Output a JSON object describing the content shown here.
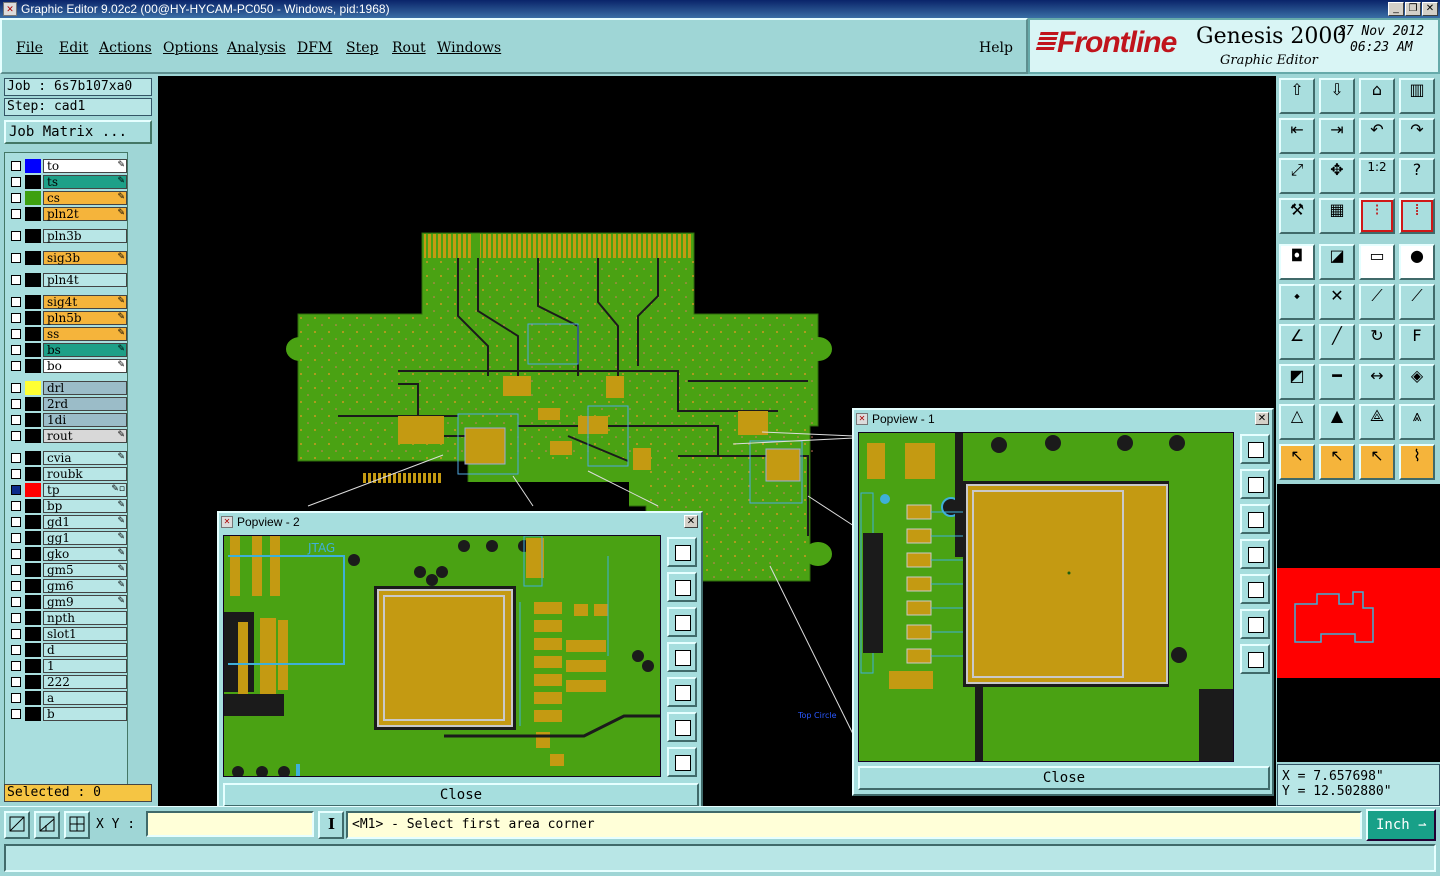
{
  "window": {
    "title": "Graphic Editor 9.02c2 (00@HY-HYCAM-PC050 - Windows, pid:1968)",
    "controls": [
      "_",
      "❐",
      "✕"
    ]
  },
  "menu": [
    "File",
    "Edit",
    "Actions",
    "Options",
    "Analysis",
    "DFM",
    "Step",
    "Rout",
    "Windows"
  ],
  "help_label": "Help",
  "branding": {
    "logo": "Frontline",
    "product": "Genesis 2000",
    "subtitle": "Graphic Editor",
    "date": "27 Nov 2012",
    "time": "06:23 AM"
  },
  "job": {
    "job_text": "Job : 6s7b107xa0",
    "step_text": "Step: cad1",
    "matrix_label": "Job Matrix ..."
  },
  "layers": [
    {
      "name": "to",
      "swatch": "#0000ff",
      "bg": "#ffffff",
      "pen": "✎",
      "group": 0,
      "active": false
    },
    {
      "name": "ts",
      "swatch": "#000000",
      "bg": "#1ea088",
      "pen": "✎",
      "group": 0,
      "active": false
    },
    {
      "name": "cs",
      "swatch": "#3ea010",
      "bg": "#f5b43b",
      "pen": "✎",
      "group": 0,
      "active": false
    },
    {
      "name": "pln2t",
      "swatch": "#000000",
      "bg": "#f5b43b",
      "pen": "✎",
      "group": 0,
      "active": false
    },
    {
      "name": "pln3b",
      "swatch": "#000000",
      "bg": "#b8e6e6",
      "pen": "",
      "group": 1,
      "active": false
    },
    {
      "name": "sig3b",
      "swatch": "#000000",
      "bg": "#f5b43b",
      "pen": "✎",
      "group": 2,
      "active": false
    },
    {
      "name": "pln4t",
      "swatch": "#000000",
      "bg": "#b8e6e6",
      "pen": "",
      "group": 3,
      "active": false
    },
    {
      "name": "sig4t",
      "swatch": "#000000",
      "bg": "#f5b43b",
      "pen": "✎",
      "group": 4,
      "active": false
    },
    {
      "name": "pln5b",
      "swatch": "#000000",
      "bg": "#f5b43b",
      "pen": "✎",
      "group": 4,
      "active": false
    },
    {
      "name": "ss",
      "swatch": "#000000",
      "bg": "#f5b43b",
      "pen": "✎",
      "group": 4,
      "active": false
    },
    {
      "name": "bs",
      "swatch": "#000000",
      "bg": "#1ea088",
      "pen": "✎",
      "group": 4,
      "active": false
    },
    {
      "name": "bo",
      "swatch": "#000000",
      "bg": "#ffffff",
      "pen": "✎",
      "group": 4,
      "active": false
    },
    {
      "name": "drl",
      "swatch": "#ffff33",
      "bg": "#9bbcc8",
      "pen": "",
      "group": 5,
      "active": false
    },
    {
      "name": "2rd",
      "swatch": "#000000",
      "bg": "#9bbcc8",
      "pen": "",
      "group": 5,
      "active": false
    },
    {
      "name": "1di",
      "swatch": "#000000",
      "bg": "#9bbcc8",
      "pen": "",
      "group": 5,
      "active": false
    },
    {
      "name": "rout",
      "swatch": "#000000",
      "bg": "#d8d8d8",
      "pen": "✎",
      "group": 5,
      "active": false
    },
    {
      "name": "cvia",
      "swatch": "#000000",
      "bg": "#b8e6e6",
      "pen": "✎",
      "group": 6,
      "active": false
    },
    {
      "name": "roubk",
      "swatch": "#000000",
      "bg": "#b8e6e6",
      "pen": "",
      "group": 6,
      "active": false
    },
    {
      "name": "tp",
      "swatch": "#ff0000",
      "bg": "#b8e6e6",
      "pen": "✎▫",
      "group": 6,
      "active": true
    },
    {
      "name": "bp",
      "swatch": "#000000",
      "bg": "#b8e6e6",
      "pen": "✎",
      "group": 6,
      "active": false
    },
    {
      "name": "gd1",
      "swatch": "#000000",
      "bg": "#b8e6e6",
      "pen": "✎",
      "group": 6,
      "active": false
    },
    {
      "name": "gg1",
      "swatch": "#000000",
      "bg": "#b8e6e6",
      "pen": "✎",
      "group": 6,
      "active": false
    },
    {
      "name": "gko",
      "swatch": "#000000",
      "bg": "#b8e6e6",
      "pen": "✎",
      "group": 6,
      "active": false
    },
    {
      "name": "gm5",
      "swatch": "#000000",
      "bg": "#b8e6e6",
      "pen": "✎",
      "group": 6,
      "active": false
    },
    {
      "name": "gm6",
      "swatch": "#000000",
      "bg": "#b8e6e6",
      "pen": "✎",
      "group": 6,
      "active": false
    },
    {
      "name": "gm9",
      "swatch": "#000000",
      "bg": "#b8e6e6",
      "pen": "✎",
      "group": 6,
      "active": false
    },
    {
      "name": "npth",
      "swatch": "#000000",
      "bg": "#b8e6e6",
      "pen": "",
      "group": 6,
      "active": false
    },
    {
      "name": "slot1",
      "swatch": "#000000",
      "bg": "#b8e6e6",
      "pen": "",
      "group": 6,
      "active": false
    },
    {
      "name": "d",
      "swatch": "#000000",
      "bg": "#b8e6e6",
      "pen": "",
      "group": 6,
      "active": false
    },
    {
      "name": "1",
      "swatch": "#000000",
      "bg": "#b8e6e6",
      "pen": "",
      "group": 6,
      "active": false
    },
    {
      "name": "222",
      "swatch": "#000000",
      "bg": "#b8e6e6",
      "pen": "",
      "group": 6,
      "active": false
    },
    {
      "name": "a",
      "swatch": "#000000",
      "bg": "#b8e6e6",
      "pen": "",
      "group": 6,
      "active": false
    },
    {
      "name": "b",
      "swatch": "#000000",
      "bg": "#b8e6e6",
      "pen": "",
      "group": 6,
      "active": false
    }
  ],
  "selected_text": "Selected : 0",
  "popview1": {
    "title": "Popview - 1",
    "close_label": "Close"
  },
  "popview2": {
    "title": "Popview - 2",
    "close_label": "Close",
    "silk_text": "JTAG"
  },
  "canvas_annotation": "Top Circle",
  "toolbar_icons": [
    {
      "name": "load-icon",
      "glyph": "⇧",
      "style": "plain"
    },
    {
      "name": "save-icon",
      "glyph": "⇩",
      "style": "plain"
    },
    {
      "name": "home-icon",
      "glyph": "⌂",
      "style": "plain"
    },
    {
      "name": "window-split-icon",
      "glyph": "▥",
      "style": "plain"
    },
    {
      "name": "pan-left-icon",
      "glyph": "⇤",
      "style": "plain"
    },
    {
      "name": "pan-right-icon",
      "glyph": "⇥",
      "style": "plain"
    },
    {
      "name": "undo-icon",
      "glyph": "↶",
      "style": "plain"
    },
    {
      "name": "redo-icon",
      "glyph": "↷",
      "style": "plain"
    },
    {
      "name": "fit-vertical-icon",
      "glyph": "⤢",
      "style": "plain"
    },
    {
      "name": "zoom-center-icon",
      "glyph": "✥",
      "style": "plain"
    },
    {
      "name": "scale-1-2-icon",
      "glyph": "1:2",
      "style": "plain"
    },
    {
      "name": "help-icon",
      "glyph": "?",
      "style": "plain"
    },
    {
      "name": "tools-icon",
      "glyph": "⚒",
      "style": "plain"
    },
    {
      "name": "grid-icon",
      "glyph": "▦",
      "style": "plain"
    },
    {
      "name": "net-red-icon",
      "glyph": "⁝",
      "style": "red"
    },
    {
      "name": "net-red-2-icon",
      "glyph": "⁞",
      "style": "red"
    },
    {
      "name": "cursor-pad-icon",
      "glyph": "◘",
      "style": "white"
    },
    {
      "name": "measure-angle-icon",
      "glyph": "◪",
      "style": "plain"
    },
    {
      "name": "ruler-icon",
      "glyph": "▭",
      "style": "white"
    },
    {
      "name": "dot-select-icon",
      "glyph": "●",
      "style": "white"
    },
    {
      "name": "connect-pads-icon",
      "glyph": "⬩",
      "style": "plain"
    },
    {
      "name": "cross-icon",
      "glyph": "✕",
      "style": "plain"
    },
    {
      "name": "line-pads-icon",
      "glyph": "⟋",
      "style": "plain"
    },
    {
      "name": "line-pads-2-icon",
      "glyph": "⟋",
      "style": "plain"
    },
    {
      "name": "angle-icon",
      "glyph": "∠",
      "style": "plain"
    },
    {
      "name": "slash-icon",
      "glyph": "╱",
      "style": "plain"
    },
    {
      "name": "arc-icon",
      "glyph": "↻",
      "style": "plain"
    },
    {
      "name": "text-f-icon",
      "glyph": "F",
      "style": "plain"
    },
    {
      "name": "pad-icon",
      "glyph": "◩",
      "style": "plain"
    },
    {
      "name": "minus-icon",
      "glyph": "━",
      "style": "plain"
    },
    {
      "name": "dimension-icon",
      "glyph": "↔",
      "style": "plain"
    },
    {
      "name": "shapes-icon",
      "glyph": "◈",
      "style": "plain"
    },
    {
      "name": "triangle-icon",
      "glyph": "△",
      "style": "plain"
    },
    {
      "name": "triangle-2-icon",
      "glyph": "▲",
      "style": "plain"
    },
    {
      "name": "triangle-3-icon",
      "glyph": "⟁",
      "style": "plain"
    },
    {
      "name": "triangle-4-icon",
      "glyph": "⩓",
      "style": "plain"
    },
    {
      "name": "select-arrow-icon",
      "glyph": "↖",
      "style": "orange"
    },
    {
      "name": "select-arrow-box-icon",
      "glyph": "↖",
      "style": "orange"
    },
    {
      "name": "select-arrow-box-2-icon",
      "glyph": "↖",
      "style": "orange"
    },
    {
      "name": "select-net-icon",
      "glyph": "⌇",
      "style": "orange"
    }
  ],
  "coordinates": {
    "x": "X = 7.657698\"",
    "y": "Y = 12.502880\""
  },
  "bottom": {
    "xy_label": "X Y :",
    "xy_value": "",
    "message": "<M1> - Select first area corner",
    "unit": "Inch",
    "unit_arrow": "⇀"
  }
}
